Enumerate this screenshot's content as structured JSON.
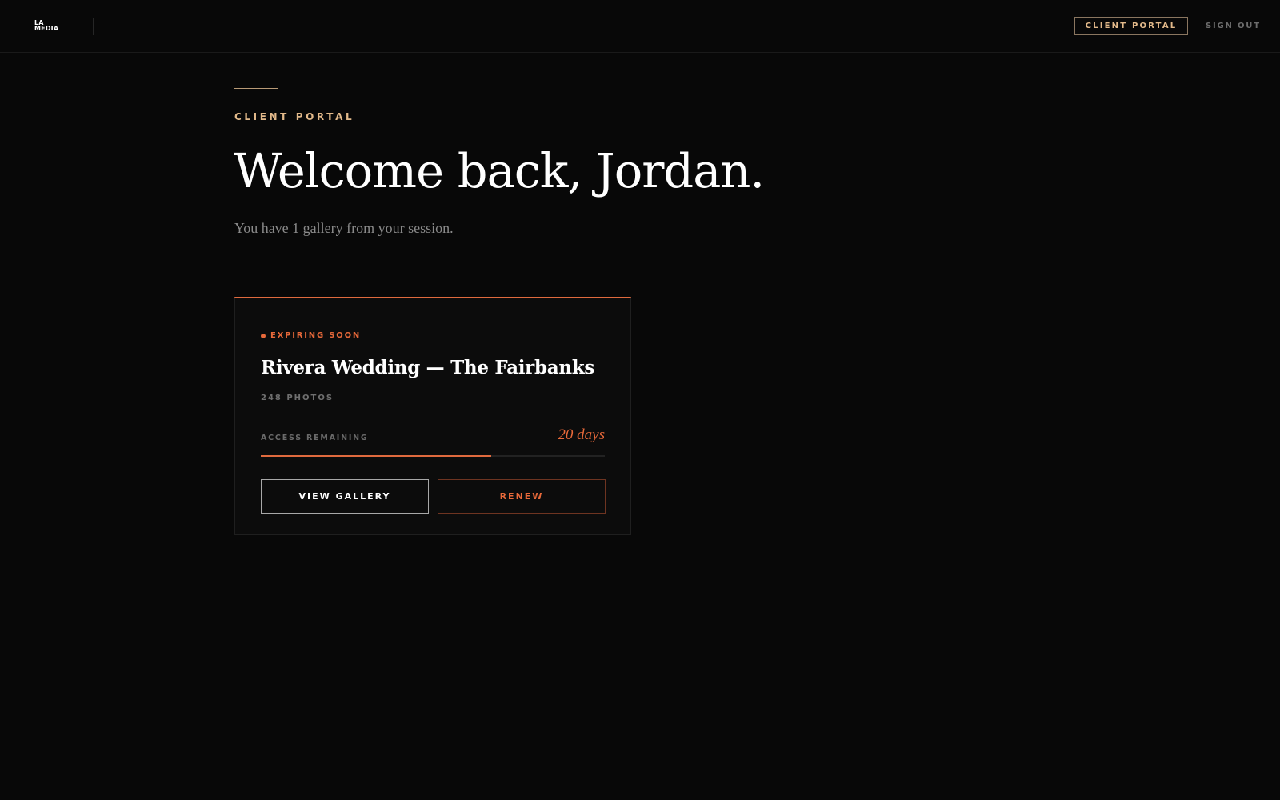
{
  "header": {
    "logo_line1": "LA",
    "logo_line2": "MEDIA",
    "nav_client_portal": "CLIENT PORTAL",
    "nav_sign_out": "SIGN OUT"
  },
  "hero": {
    "eyebrow": "CLIENT PORTAL",
    "title": "Welcome back, Jordan.",
    "subtitle": "You have 1 gallery from your session."
  },
  "gallery_card": {
    "status_badge": "EXPIRING SOON",
    "title": "Rivera Wedding — The Fairbanks",
    "photo_count": "248 PHOTOS",
    "access_label": "ACCESS REMAINING",
    "access_value": "20 days",
    "access_progress": 0.67,
    "view_button": "VIEW GALLERY",
    "renew_button": "RENEW"
  },
  "colors": {
    "background": "#080808",
    "accent_orange": "#e8693a",
    "accent_gold": "#e2b98a",
    "text_primary": "#ffffff",
    "text_muted": "#8a8a8a"
  }
}
